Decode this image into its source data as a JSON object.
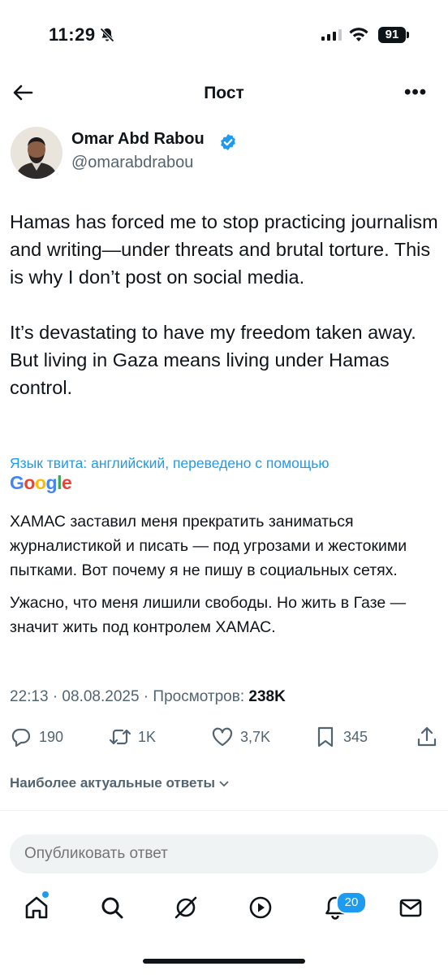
{
  "status_bar": {
    "time": "11:29",
    "battery": "91"
  },
  "header": {
    "title": "Пост",
    "back_icon": "arrow-left-icon",
    "more_icon": "more-horizontal-icon"
  },
  "author": {
    "name": "Omar Abd Rabou",
    "handle": "@omarabdrabou",
    "verified": true,
    "verified_color": "#1d9bf0"
  },
  "tweet": {
    "paragraphs": [
      "Hamas has forced me to stop practicing journalism and writing—under threats and brutal torture. This is why I don’t post on social media.",
      "It’s devastating to have my freedom taken away. But living in Gaza means living under Hamas control."
    ]
  },
  "translation": {
    "note": "Язык твита: английский, переведено с помощью",
    "provider": "Google",
    "paragraphs": [
      "ХАМАС заставил меня прекратить заниматься журналистикой и писать — под угрозами и жестокими пытками. Вот почему я не пишу в социальных сетях.",
      "Ужасно, что меня лишили свободы. Но жить в Газе — значит жить под контролем ХАМАС."
    ]
  },
  "meta": {
    "time_date": "22:13 · 08.08.2025 · Просмотров: ",
    "views": "238K"
  },
  "actions": {
    "replies": "190",
    "reposts": "1K",
    "likes": "3,7K",
    "bookmarks": "345"
  },
  "replies_sort": {
    "label": "Наиболее актуальные ответы"
  },
  "reply_box": {
    "placeholder": "Опубликовать ответ"
  },
  "bottom_nav": {
    "items": [
      "home-icon",
      "search-icon",
      "grok-icon",
      "video-icon",
      "notifications-icon",
      "messages-icon"
    ],
    "notifications_badge": "20"
  },
  "colors": {
    "accent": "#1d9bf0",
    "text": "#0f1419",
    "secondary": "#536471"
  }
}
